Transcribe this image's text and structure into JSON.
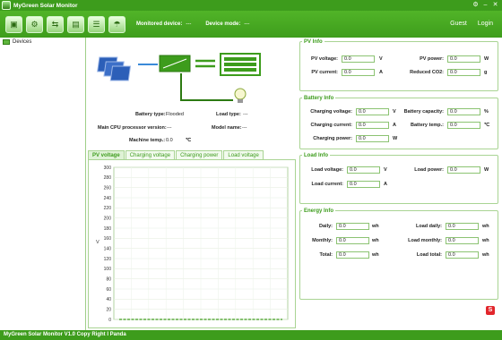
{
  "window": {
    "title": "MyGreen Solar Monitor",
    "controls": {
      "settings": "⚙",
      "minimize": "–",
      "close": "✕"
    }
  },
  "toolbar": {
    "monitored_device_label": "Monitored device:",
    "monitored_device_value": "---",
    "device_mode_label": "Device mode:",
    "device_mode_value": "---",
    "guest_label": "Guest",
    "login_label": "Login",
    "tools": [
      "▣",
      "⚙",
      "⇆",
      "▤",
      "☰",
      "☂"
    ]
  },
  "sidebar": {
    "items": [
      {
        "label": "Devices",
        "icon": "monitor-icon"
      }
    ]
  },
  "device_info": {
    "battery_type_label": "Battery type:",
    "battery_type_value": "Flooded",
    "load_type_label": "Load type:",
    "load_type_value": "---",
    "cpu_version_label": "Main CPU processor version:",
    "cpu_version_value": "---",
    "model_name_label": "Model name:",
    "model_name_value": "---",
    "machine_temp_label": "Machine temp.:",
    "machine_temp_value": "0.0",
    "machine_temp_unit": "℃"
  },
  "tabs": [
    "PV voltage",
    "Charging voltage",
    "Charging power",
    "Load voltage"
  ],
  "active_tab": 0,
  "chart_data": {
    "type": "line",
    "ylabel": "V",
    "ylim": [
      0,
      300
    ],
    "yticks": [
      0,
      20,
      40,
      60,
      80,
      100,
      120,
      140,
      160,
      180,
      200,
      220,
      240,
      260,
      280,
      300
    ],
    "series": [
      {
        "values": [
          0,
          0,
          0,
          0,
          0,
          0,
          0,
          0,
          0,
          0,
          0,
          0,
          0,
          0,
          0,
          0,
          0,
          0,
          0,
          0,
          0,
          0,
          0,
          0,
          0,
          0,
          0,
          0,
          0,
          0,
          0,
          0
        ]
      }
    ],
    "line_color": "#3d9c1c",
    "grid": true
  },
  "pv_info": {
    "title": "PV Info",
    "pv_voltage_label": "PV voltage:",
    "pv_voltage_value": "0.0",
    "pv_voltage_unit": "V",
    "pv_power_label": "PV power:",
    "pv_power_value": "0.0",
    "pv_power_unit": "W",
    "pv_current_label": "PV current:",
    "pv_current_value": "0.0",
    "pv_current_unit": "A",
    "reduced_co2_label": "Reduced CO2:",
    "reduced_co2_value": "0.0",
    "reduced_co2_unit": "g"
  },
  "battery_info": {
    "title": "Battery Info",
    "charging_voltage_label": "Charging voltage:",
    "charging_voltage_value": "0.0",
    "charging_voltage_unit": "V",
    "battery_capacity_label": "Battery capacity:",
    "battery_capacity_value": "0.0",
    "battery_capacity_unit": "%",
    "charging_current_label": "Charging current:",
    "charging_current_value": "0.0",
    "charging_current_unit": "A",
    "battery_temp_label": "Battery temp.:",
    "battery_temp_value": "0.0",
    "battery_temp_unit": "℃",
    "charging_power_label": "Charging power:",
    "charging_power_value": "0.0",
    "charging_power_unit": "W"
  },
  "load_info": {
    "title": "Load Info",
    "load_voltage_label": "Load voltage:",
    "load_voltage_value": "0.0",
    "load_voltage_unit": "V",
    "load_power_label": "Load power:",
    "load_power_value": "0.0",
    "load_power_unit": "W",
    "load_current_label": "Load current:",
    "load_current_value": "0.0",
    "load_current_unit": "A"
  },
  "energy_info": {
    "title": "Energy Info",
    "daily_label": "Daily:",
    "daily_value": "0.0",
    "daily_unit": "wh",
    "load_daily_label": "Load daily:",
    "load_daily_value": "0.0",
    "load_daily_unit": "wh",
    "monthly_label": "Monthly:",
    "monthly_value": "0.0",
    "monthly_unit": "wh",
    "load_monthly_label": "Load monthly:",
    "load_monthly_value": "0.0",
    "load_monthly_unit": "wh",
    "total_label": "Total:",
    "total_value": "0.0",
    "total_unit": "wh",
    "load_total_label": "Load total:",
    "load_total_value": "0.0",
    "load_total_unit": "wh"
  },
  "statusbar": {
    "text": "MyGreen Solar Monitor V1.0   Copy Right I Panda"
  },
  "ime_badge": "S"
}
